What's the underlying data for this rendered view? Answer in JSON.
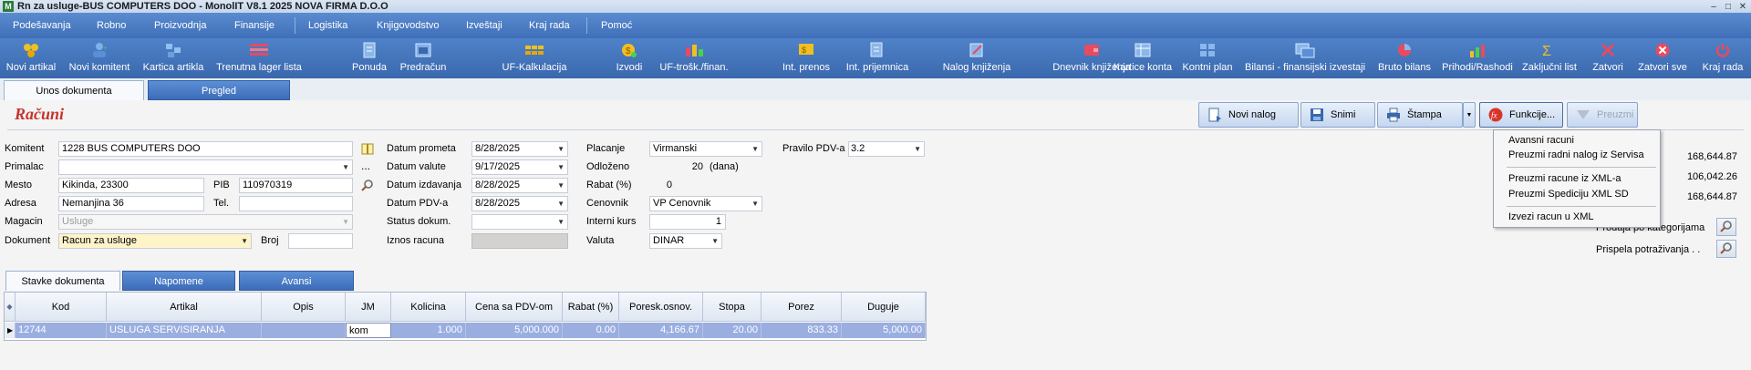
{
  "window": {
    "title": "Rn za usluge-BUS COMPUTERS DOO - MonolIT V8.1 2025 NOVA FIRMA D.O.O",
    "app_icon": "monolit-logo-icon",
    "controls": [
      "minimize",
      "restore",
      "close"
    ]
  },
  "menu": {
    "items": [
      "Podešavanja",
      "Robno",
      "Proizvodnja",
      "Finansije",
      "Logistika",
      "Knjigovodstvo",
      "Izveštaji",
      "Kraj rada",
      "Pomoć"
    ]
  },
  "toolbar": {
    "buttons": [
      {
        "label": "Novi artikal",
        "icon": "new-article-icon"
      },
      {
        "label": "Novi komitent",
        "icon": "new-client-icon"
      },
      {
        "label": "Kartica artikla",
        "icon": "article-card-icon"
      },
      {
        "label": "Trenutna lager lista",
        "icon": "stock-list-icon"
      },
      {
        "label": "Ponuda",
        "icon": "offer-icon"
      },
      {
        "label": "Predračun",
        "icon": "proforma-icon"
      },
      {
        "label": "UF-Kalkulacija",
        "icon": "calculation-icon"
      },
      {
        "label": "Izvodi",
        "icon": "statements-icon"
      },
      {
        "label": "UF-trošk./finan.",
        "icon": "costs-icon"
      },
      {
        "label": "Int. prenos",
        "icon": "internal-transfer-icon"
      },
      {
        "label": "Int. prijemnica",
        "icon": "internal-receipt-icon"
      },
      {
        "label": "Nalog knjiženja",
        "icon": "posting-order-icon"
      },
      {
        "label": "Dnevnik knjiženja",
        "icon": "journal-icon"
      },
      {
        "label": "Kartice konta",
        "icon": "account-cards-icon"
      },
      {
        "label": "Kontni plan",
        "icon": "chart-of-accounts-icon"
      },
      {
        "label": "Bilansi - finansijski izvestaji",
        "icon": "balance-reports-icon"
      },
      {
        "label": "Bruto bilans",
        "icon": "gross-balance-icon"
      },
      {
        "label": "Prihodi/Rashodi",
        "icon": "income-expense-icon"
      },
      {
        "label": "Zaključni list",
        "icon": "closing-sheet-icon"
      },
      {
        "label": "Zatvori",
        "icon": "close-icon"
      },
      {
        "label": "Zatvori sve",
        "icon": "close-all-icon"
      },
      {
        "label": "Kraj rada",
        "icon": "power-icon"
      }
    ]
  },
  "top_tabs": [
    "Unos dokumenta",
    "Pregled"
  ],
  "page": {
    "title": "Računi",
    "actions": {
      "new_order": "Novi nalog",
      "save": "Snimi",
      "print": "Štampa",
      "functions": "Funkcije...",
      "take_over": "Preuzmi"
    }
  },
  "form": {
    "komitent_label": "Komitent",
    "komitent_value": "1228 BUS COMPUTERS DOO",
    "primalac_label": "Primalac",
    "primalac_value": "",
    "mesto_label": "Mesto",
    "mesto_value": "Kikinda, 23300",
    "pib_label": "PIB",
    "pib_value": "110970319",
    "adresa_label": "Adresa",
    "adresa_value": "Nemanjina 36",
    "tel_label": "Tel.",
    "tel_value": "",
    "magacin_label": "Magacin",
    "magacin_value": "Usluge",
    "dokument_label": "Dokument",
    "dokument_value": "Racun za usluge",
    "broj_label": "Broj",
    "broj_value": "",
    "datum_prometa_label": "Datum prometa",
    "datum_prometa_value": "8/28/2025",
    "datum_valute_label": "Datum valute",
    "datum_valute_value": "9/17/2025",
    "datum_izdavanja_label": "Datum izdavanja",
    "datum_izdavanja_value": "8/28/2025",
    "datum_pdv_label": "Datum PDV-a",
    "datum_pdv_value": "8/28/2025",
    "status_label": "Status dokum.",
    "status_value": "",
    "iznos_label": "Iznos racuna",
    "iznos_value": "",
    "placanje_label": "Placanje",
    "placanje_value": "Virmanski",
    "odlozeno_label": "Odloženo",
    "odlozeno_value": "20",
    "odlozeno_unit": "(dana)",
    "rabat_label": "Rabat (%)",
    "rabat_value": "0",
    "cenovnik_label": "Cenovnik",
    "cenovnik_value": "VP Cenovnik",
    "interni_kurs_label": "Interni kurs",
    "interni_kurs_value": "1",
    "valuta_label": "Valuta",
    "valuta_value": "DINAR",
    "pravilo_label": "Pravilo PDV-a",
    "pravilo_value": "3.2",
    "ellipsis": "..."
  },
  "totals": {
    "values": [
      "168,644.87",
      "106,042.26",
      "168,644.87"
    ],
    "link1": "Prodaja po kategorijama",
    "link2": "Prispela potraživanja . ."
  },
  "functions_menu": {
    "items": [
      "Avansni racuni",
      "Preuzmi radni nalog iz Servisa",
      "Preuzmi racune iz XML-a",
      "Preuzmi Spediciju XML SD",
      "Izvezi racun u XML"
    ]
  },
  "bottom_tabs": [
    "Stavke dokumenta",
    "Napomene",
    "Avansi"
  ],
  "grid": {
    "columns": [
      "Kod",
      "Artikal",
      "Opis",
      "JM",
      "Kolicina",
      "Cena sa PDV-om",
      "Rabat (%)",
      "Poresk.osnov.",
      "Stopa",
      "Porez",
      "Duguje"
    ],
    "rows": [
      [
        "12744",
        "USLUGA SERVISIRANJA",
        "",
        "kom",
        "1.000",
        "5,000.000",
        "0.00",
        "4,166.67",
        "20.00",
        "833.33",
        "5,000.00"
      ]
    ]
  },
  "colors": {
    "accent": "#3f6fb8",
    "title_red": "#c8332c",
    "row_selected": "#9aaee0",
    "doc_yellow": "#fff3c9"
  }
}
